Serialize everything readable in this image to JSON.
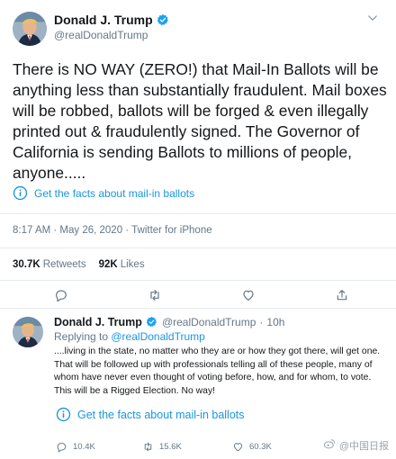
{
  "main_tweet": {
    "display_name": "Donald J. Trump",
    "handle": "@realDonaldTrump",
    "text": "There is NO WAY (ZERO!) that Mail-In Ballots will be anything less than substantially fraudulent. Mail boxes will be robbed, ballots will be forged & even illegally printed out & fraudulently signed. The Governor of California is sending Ballots to millions of people, anyone.....",
    "facts_link": "Get the facts about mail-in ballots",
    "time": "8:17 AM · May 26, 2020 · ",
    "source": "Twitter for iPhone",
    "retweets_count": "30.7K",
    "retweets_label": "Retweets",
    "likes_count": "92K",
    "likes_label": "Likes"
  },
  "reply_tweet": {
    "display_name": "Donald J. Trump",
    "handle": "@realDonaldTrump",
    "dot": "·",
    "age": "10h",
    "replying_prefix": "Replying to ",
    "replying_to": "@realDonaldTrump",
    "text": "....living in the state, no matter who they are or how they got there, will get one. That will be followed up with professionals telling all of these people, many of whom have never even thought of voting before, how, and for whom, to vote. This will be a Rigged Election. No way!",
    "facts_link": "Get the facts about mail-in ballots",
    "reply_count": "10.4K",
    "retweet_count": "15.6K",
    "like_count": "60.3K"
  },
  "watermark": "@中国日报",
  "icons": {
    "verified": "verified-badge-icon",
    "info": "info-circle-icon",
    "reply": "reply-icon",
    "retweet": "retweet-icon",
    "like": "heart-icon",
    "share": "share-icon",
    "caret": "chevron-down-icon"
  },
  "colors": {
    "accent": "#1da1f2",
    "link": "#1b95e0",
    "muted": "#657786",
    "text": "#14171a",
    "divider": "#e6ecf0"
  }
}
